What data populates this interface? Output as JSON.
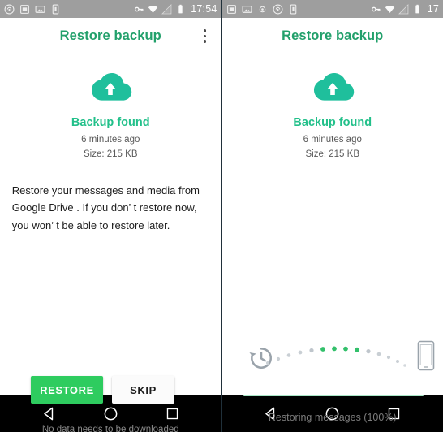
{
  "left_screen": {
    "statusbar": {
      "icons_left": [
        "sync-icon",
        "sim-card-icon",
        "image-icon",
        "sd-card-icon"
      ],
      "icons_right": [
        "vpn-key-icon",
        "wifi-icon",
        "signal-icon",
        "battery-icon"
      ],
      "time": "17:54"
    },
    "appbar": {
      "title": "Restore backup",
      "overflow_icon": "more-vert-icon"
    },
    "body": {
      "cloud_icon": "cloud-upload-icon",
      "heading": "Backup found",
      "time_ago": "6 minutes ago",
      "size": "Size: 215 KB",
      "description": "Restore your messages and media from Google Drive . If you don’ t restore now, you won’ t be able to restore later."
    },
    "buttons": {
      "restore": "RESTORE",
      "skip": "SKIP"
    },
    "footnote": "No data needs to be downloaded"
  },
  "right_screen": {
    "statusbar": {
      "icons_left": [
        "sim-card-icon",
        "image-icon",
        "dot-icon",
        "sync-icon",
        "sd-card-icon"
      ],
      "icons_right": [
        "vpn-key-icon",
        "wifi-icon",
        "signal-icon",
        "battery-icon"
      ],
      "time": "17"
    },
    "appbar": {
      "title": "Restore backup"
    },
    "body": {
      "cloud_icon": "cloud-upload-icon",
      "heading": "Backup found",
      "time_ago": "6 minutes ago",
      "size": "Size: 215 KB"
    },
    "progress": {
      "source_icon": "history-restore-icon",
      "target_icon": "smartphone-icon",
      "dot_count": 14,
      "active_dots": [
        5,
        6,
        7,
        8,
        9
      ],
      "status_text": "Restoring messages (100%)",
      "percent": "100%"
    }
  },
  "navbar": {
    "back": "back-triangle-icon",
    "home": "home-circle-icon",
    "recents": "recents-square-icon"
  },
  "colors": {
    "title_green": "#22a06b",
    "accent_green": "#22c08a",
    "button_green": "#2ecc5f",
    "statusbar_grey": "#9e9e9e",
    "progress_line": "#a8e6c6"
  }
}
